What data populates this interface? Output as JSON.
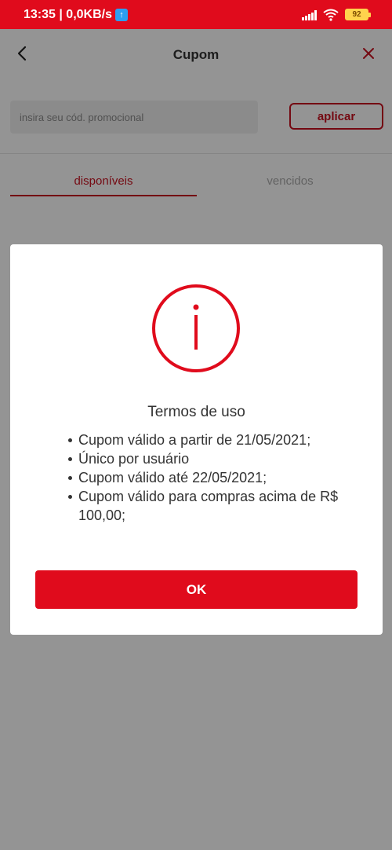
{
  "status_bar": {
    "time_speed": "13:35 | 0,0KB/s",
    "battery": "92"
  },
  "header": {
    "title": "Cupom"
  },
  "promo": {
    "placeholder": "insira seu cód. promocional",
    "apply_label": "aplicar"
  },
  "tabs": [
    {
      "label": "disponíveis",
      "active": true
    },
    {
      "label": "vencidos",
      "active": false
    }
  ],
  "dialog": {
    "title": "Termos de uso",
    "terms": [
      "Cupom válido a partir de 21/05/2021;",
      "Único por usuário",
      "Cupom válido até 22/05/2021;",
      "Cupom válido para compras acima de R$ 100,00;"
    ],
    "ok_label": "OK"
  },
  "colors": {
    "brand_red": "#e00b1c",
    "overlay": "rgba(0,0,0,0.42)"
  },
  "icons": [
    "back-arrow-icon",
    "close-icon",
    "info-icon",
    "upload-icon",
    "signal-icon",
    "wifi-icon",
    "battery-icon"
  ]
}
